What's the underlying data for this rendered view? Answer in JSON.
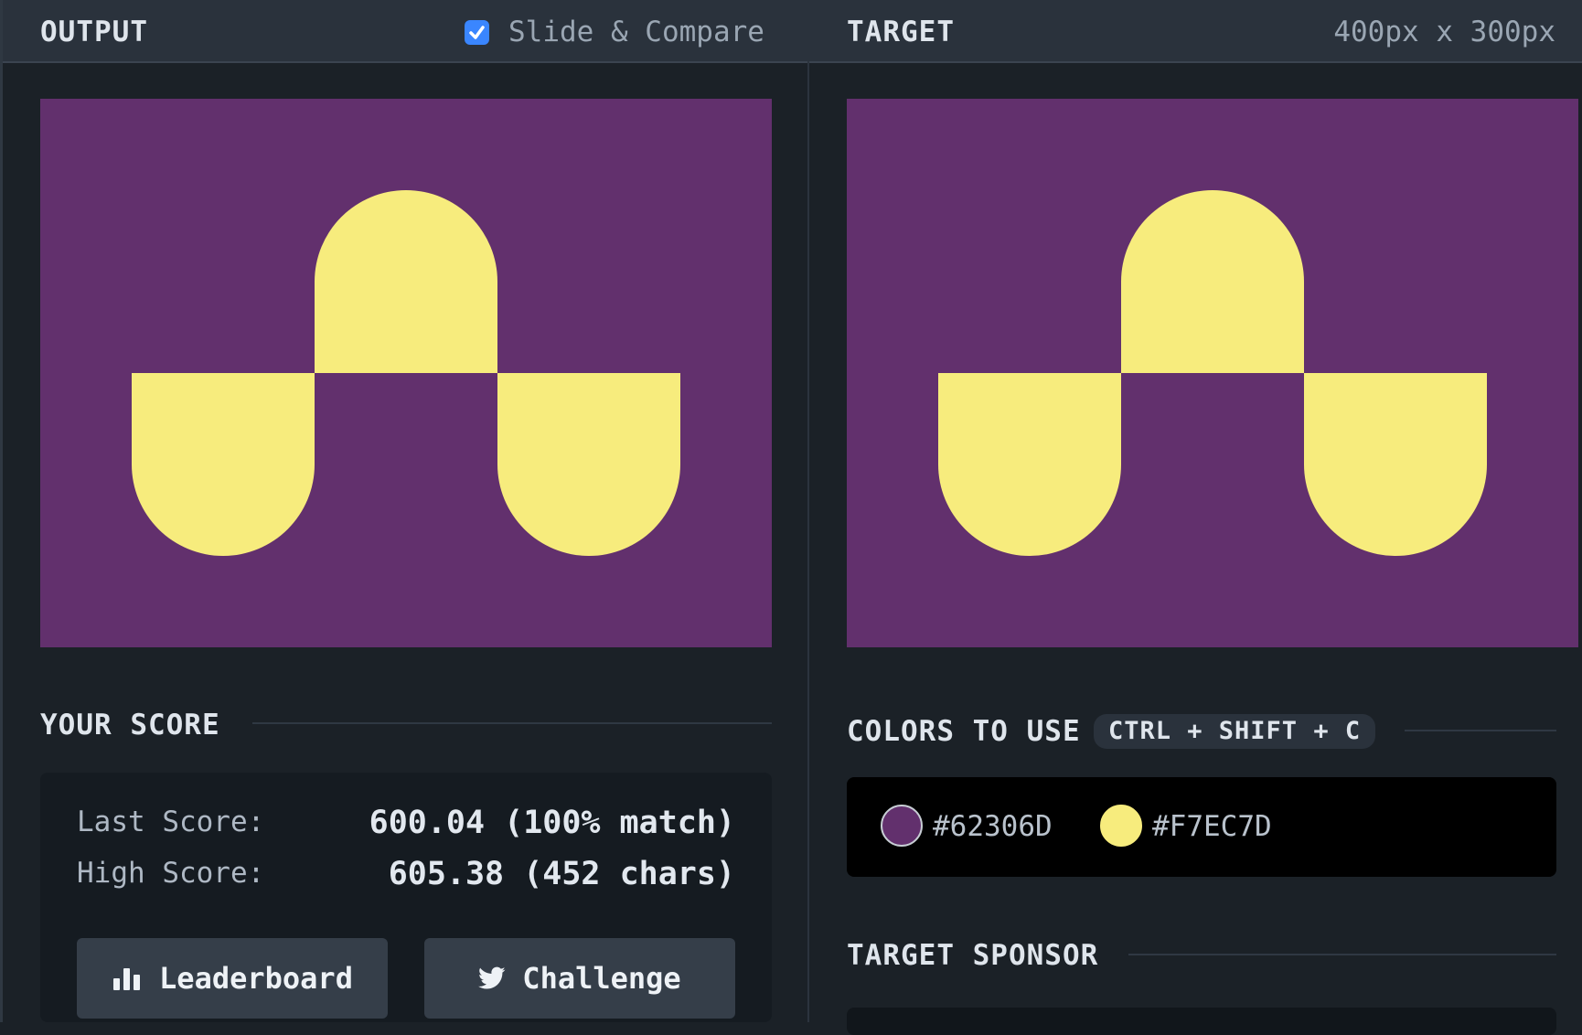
{
  "header": {
    "output_label": "OUTPUT",
    "slide_compare_label": "Slide & Compare",
    "slide_compare_checked": true,
    "target_label": "TARGET",
    "target_size": "400px x 300px"
  },
  "colors": {
    "background": "#62306D",
    "foreground": "#F7EC7D",
    "checkbox_accent": "#3A86FF"
  },
  "score": {
    "title": "YOUR SCORE",
    "last_label": "Last Score:",
    "last_value": "600.04 (100% match)",
    "high_label": "High Score:",
    "high_value": "605.38 (452 chars)",
    "leaderboard_button": "Leaderboard",
    "challenge_button": "Challenge"
  },
  "palette": {
    "title": "COLORS TO USE",
    "shortcut": "CTRL + SHIFT + C",
    "swatches": [
      {
        "hex": "#62306D",
        "icon": "purple-swatch-icon"
      },
      {
        "hex": "#F7EC7D",
        "icon": "yellow-swatch-icon"
      }
    ]
  },
  "sponsor": {
    "title": "TARGET SPONSOR"
  },
  "icons": {
    "checkbox": "checkmark-icon",
    "leaderboard": "bar-chart-icon",
    "challenge": "twitter-bird-icon"
  }
}
